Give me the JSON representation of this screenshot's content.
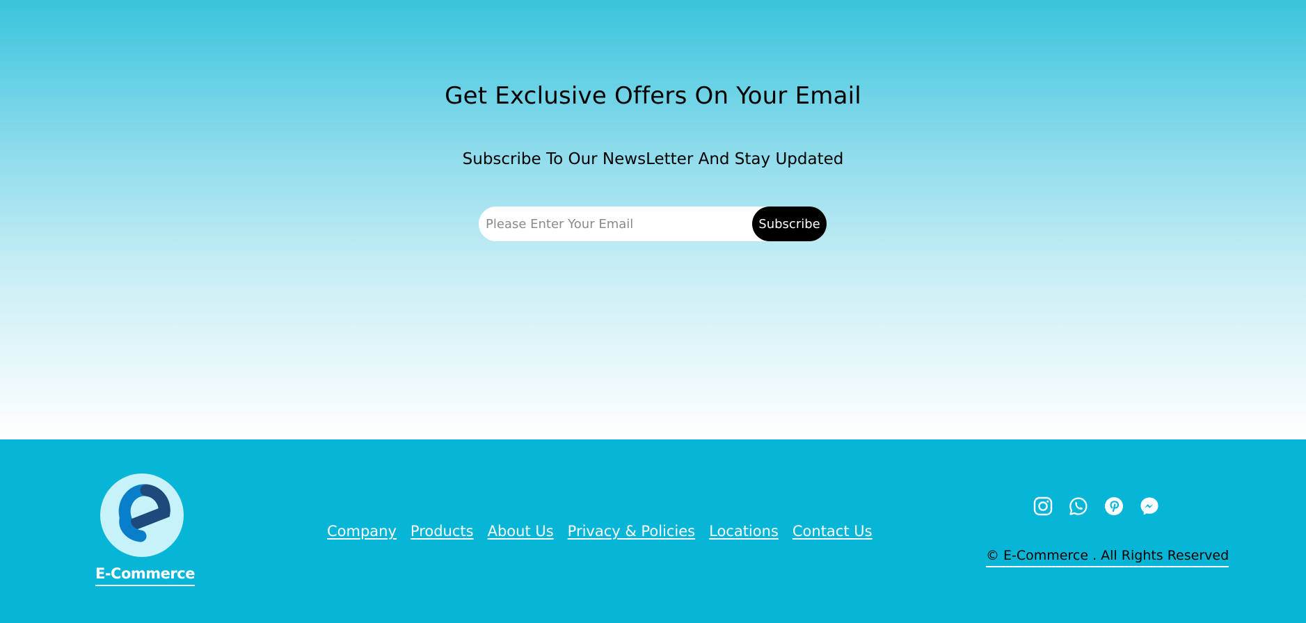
{
  "newsletter": {
    "title": "Get Exclusive Offers On Your Email",
    "subtitle": "Subscribe To Our NewsLetter And Stay Updated",
    "email_placeholder": "Please Enter Your Email",
    "subscribe_label": "Subscribe"
  },
  "footer": {
    "brand_name": "E-Commerce",
    "nav": [
      "Company",
      "Products",
      "About Us",
      "Privacy & Policies",
      "Locations",
      "Contact Us"
    ],
    "social_icons": [
      "instagram-icon",
      "whatsapp-icon",
      "pinterest-icon",
      "messenger-icon"
    ],
    "copyright": "© E-Commerce . All Rights Reserved"
  },
  "colors": {
    "footer_bg": "#07b5d6",
    "gradient_top": "#3ac4dd",
    "gradient_bottom": "#ffffff",
    "button_bg": "#000000",
    "logo_circle": "#c8f2f9",
    "logo_blue": "#0a7fc9",
    "logo_navy": "#1d4a7a"
  }
}
